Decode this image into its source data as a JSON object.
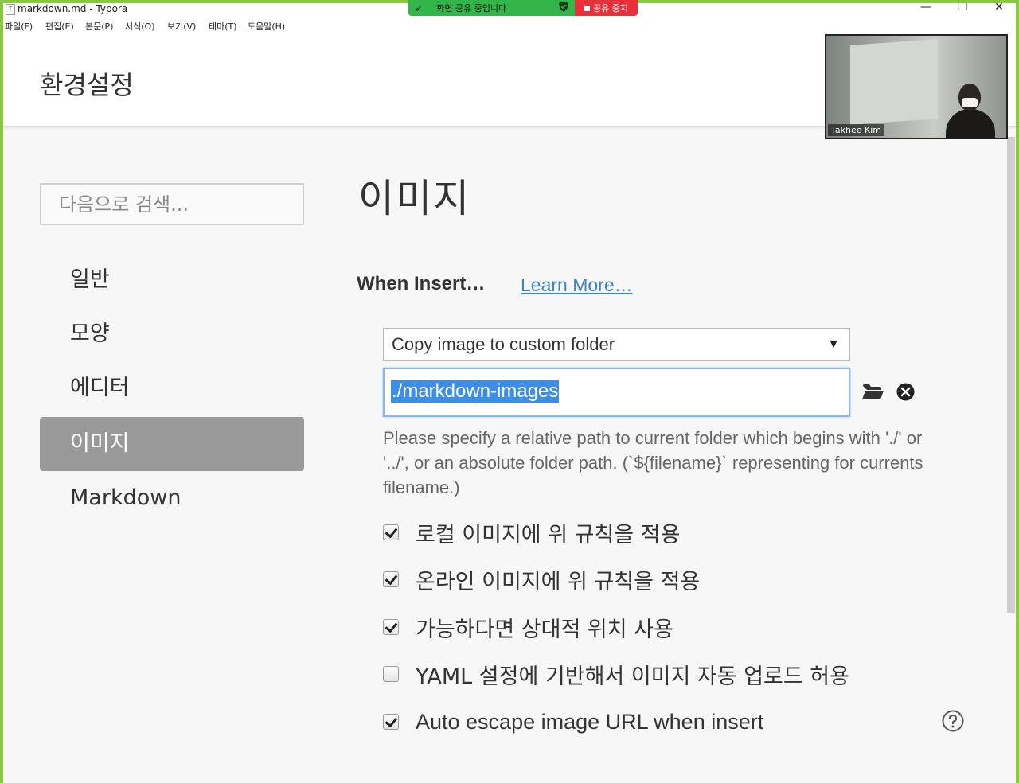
{
  "window": {
    "title": "markdown.md - Typora",
    "app_icon": "T",
    "controls": {
      "minimize": "—",
      "restore": "❐",
      "close": "✕"
    }
  },
  "menu": {
    "items": [
      "파일(F)",
      "편집(E)",
      "본문(P)",
      "서식(O)",
      "보기(V)",
      "테마(T)",
      "도움말(H)"
    ]
  },
  "share": {
    "status": "화면 공유 중입니다",
    "stop": "공유 중지",
    "green_color": "#34b54a",
    "red_color": "#e8303a"
  },
  "header": {
    "title": "환경설정"
  },
  "video": {
    "participant_name": "Takhee Kim"
  },
  "sidebar": {
    "search_placeholder": "다음으로 검색...",
    "items": [
      {
        "label": "일반",
        "active": false
      },
      {
        "label": "모양",
        "active": false
      },
      {
        "label": "에디터",
        "active": false
      },
      {
        "label": "이미지",
        "active": true
      },
      {
        "label": "Markdown",
        "active": false
      }
    ]
  },
  "main": {
    "title": "이미지",
    "section": "When Insert…",
    "learn_more": "Learn More…",
    "select_value": "Copy image to custom folder",
    "select_arrow": "▼",
    "path_value": "./markdown-images",
    "hint": " Please specify a relative path to current folder which begins with './' or '../', or an absolute folder path. (`${filename}` representing for currents filename.)",
    "options": [
      {
        "label": "로컬 이미지에 위 규칙을 적용",
        "checked": true
      },
      {
        "label": "온라인 이미지에 위 규칙을 적용",
        "checked": true
      },
      {
        "label": "가능하다면 상대적 위치 사용",
        "checked": true
      },
      {
        "label": "YAML 설정에 기반해서 이미지 자동 업로드 허용",
        "checked": false
      },
      {
        "label": "Auto escape image URL when insert",
        "checked": true
      }
    ],
    "accent_color": "#4183c4",
    "selection_color": "#3d8ee8"
  },
  "icons": [
    "folder-icon",
    "clear-icon",
    "help-icon",
    "shield-icon",
    "stop-icon"
  ]
}
